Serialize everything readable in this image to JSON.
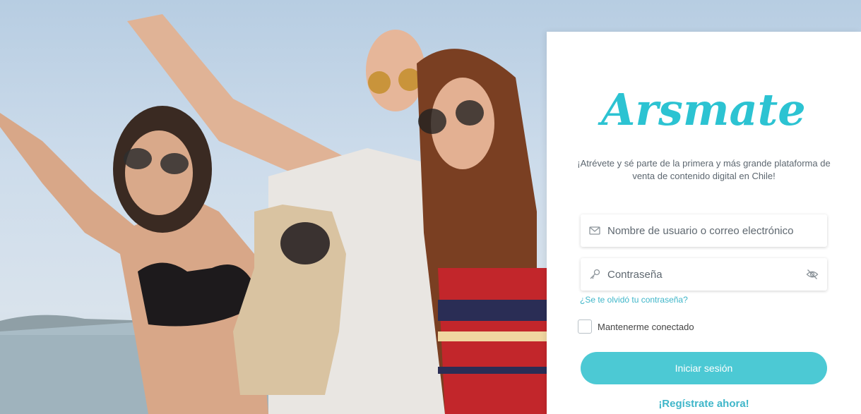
{
  "brand": {
    "name": "Arsmate",
    "color": "#2cc3d2"
  },
  "tagline": "¡Atrévete y sé parte de la primera y más grande plataforma de venta de contenido digital en Chile!",
  "form": {
    "username_placeholder": "Nombre de usuario o correo electrónico",
    "password_placeholder": "Contraseña",
    "forgot_link": "¿Se te olvidó tu contraseña?",
    "remember_label": "Mantenerme conectado",
    "login_button": "Iniciar sesión",
    "register_link": "¡Regístrate ahora!"
  },
  "icons": {
    "username": "mail-icon",
    "password": "key-icon",
    "toggle_visibility": "eye-off-icon"
  },
  "colors": {
    "accent": "#4cc9d4",
    "link": "#3fb6c9"
  }
}
